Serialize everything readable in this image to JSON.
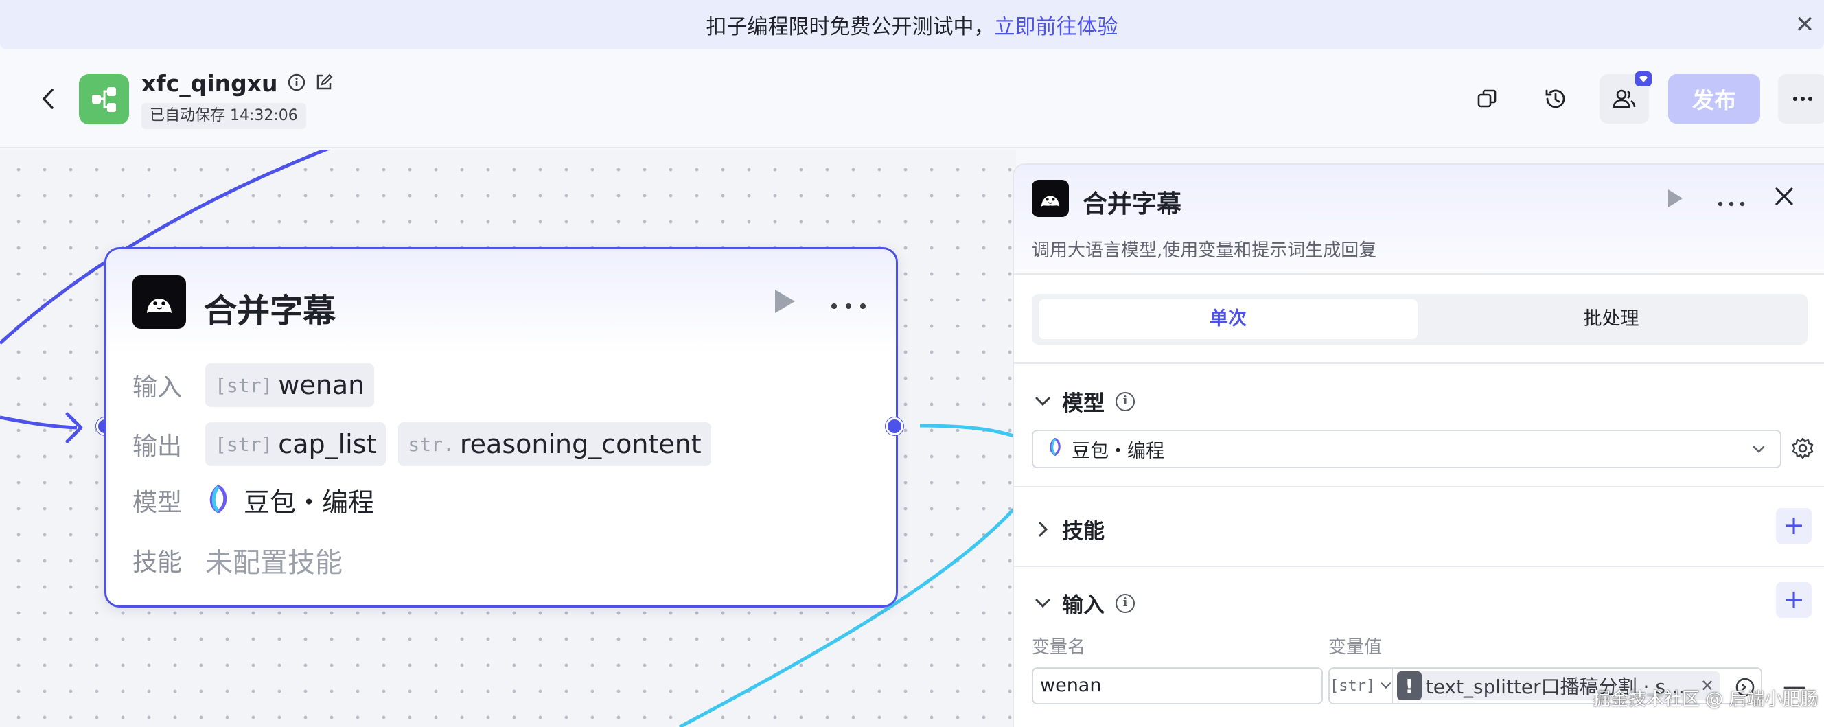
{
  "banner": {
    "text": "扣子编程限时免费公开测试中，",
    "link": "立即前往体验"
  },
  "header": {
    "app_name": "xfc_qingxu",
    "save_status": "已自动保存 14:32:06",
    "publish_label": "发布"
  },
  "node": {
    "title": "合并字幕",
    "rows": {
      "input_label": "输入",
      "output_label": "输出",
      "model_label": "模型",
      "skill_label": "技能"
    },
    "input_vars": [
      {
        "type": "[str]",
        "name": "wenan"
      }
    ],
    "output_vars": [
      {
        "type": "[str]",
        "name": "cap_list"
      },
      {
        "type": "str.",
        "name": "reasoning_content"
      }
    ],
    "model": "豆包・编程",
    "skill": "未配置技能"
  },
  "panel": {
    "title": "合并字幕",
    "description": "调用大语言模型,使用变量和提示词生成回复",
    "tabs": [
      {
        "label": "单次",
        "active": true
      },
      {
        "label": "批处理",
        "active": false
      }
    ],
    "sections": {
      "model_title": "模型",
      "skill_title": "技能",
      "input_title": "输入"
    },
    "model_select": "豆包・编程",
    "input_columns": {
      "name": "变量名",
      "value": "变量值"
    },
    "input_row": {
      "name": "wenan",
      "type": "[str]",
      "reference": "text_splitter口播稿分割 - segments",
      "reference_display": "text_splitter口播稿分割 · segm..."
    }
  },
  "watermark": "掘金技术社区 @ 后端小肥肠",
  "colors": {
    "accent": "#4d53e8",
    "edge_blue": "#4d53e8",
    "edge_cyan": "#3ec7f0",
    "app_icon": "#5ec26a",
    "publish_disabled": "#c2c6fa"
  }
}
